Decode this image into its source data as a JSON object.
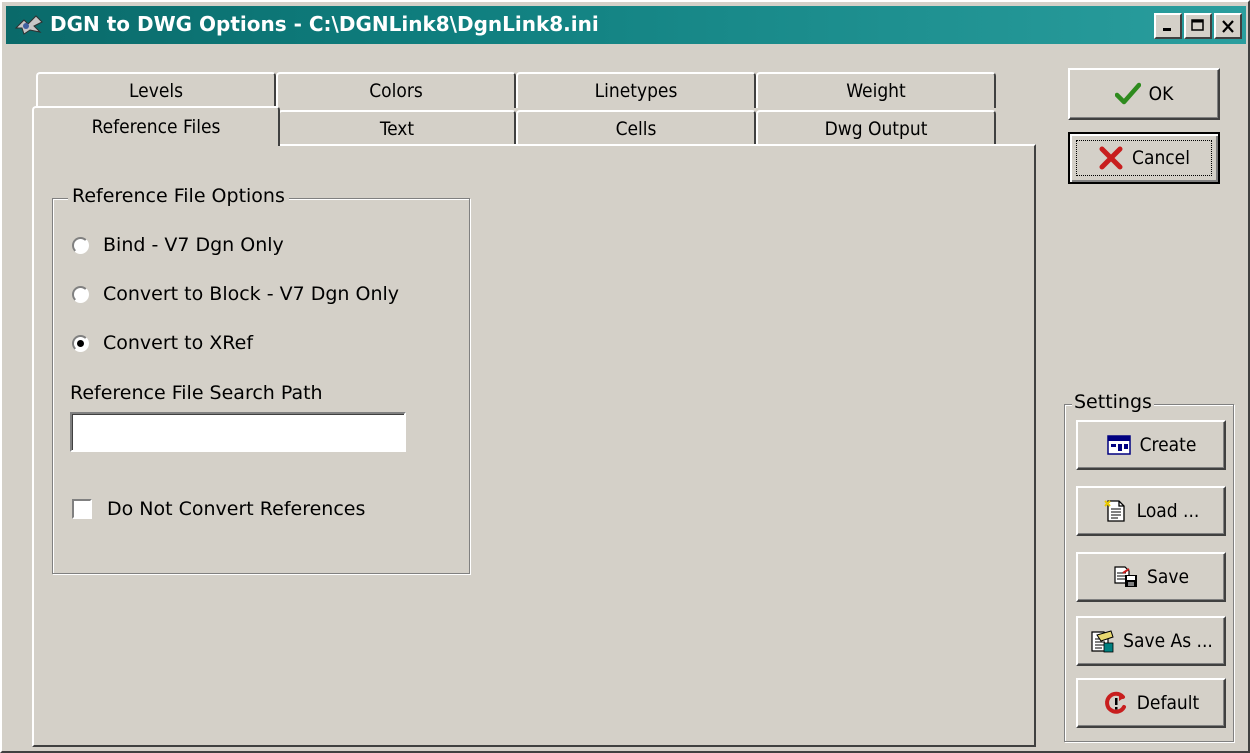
{
  "window": {
    "title": "DGN to DWG Options - C:\\DGNLink8\\DgnLink8.ini"
  },
  "tabs": {
    "row1": [
      {
        "label": "Levels"
      },
      {
        "label": "Colors"
      },
      {
        "label": "Linetypes"
      },
      {
        "label": "Weight"
      }
    ],
    "row2": [
      {
        "label": "Reference Files",
        "active": true
      },
      {
        "label": "Text"
      },
      {
        "label": "Cells"
      },
      {
        "label": "Dwg Output"
      }
    ]
  },
  "reference_options": {
    "group_label": "Reference File Options",
    "radios": [
      {
        "label": "Bind - V7 Dgn Only",
        "checked": false
      },
      {
        "label": "Convert to Block - V7 Dgn Only",
        "checked": false
      },
      {
        "label": "Convert to XRef",
        "checked": true
      }
    ],
    "search_path_label": "Reference File Search Path",
    "search_path_value": "",
    "do_not_convert_label": "Do Not Convert References",
    "do_not_convert_checked": false
  },
  "buttons": {
    "ok": "OK",
    "cancel": "Cancel"
  },
  "settings": {
    "group_label": "Settings",
    "create": "Create",
    "load": "Load ...",
    "save": "Save",
    "save_as": "Save As ...",
    "default": "Default"
  }
}
